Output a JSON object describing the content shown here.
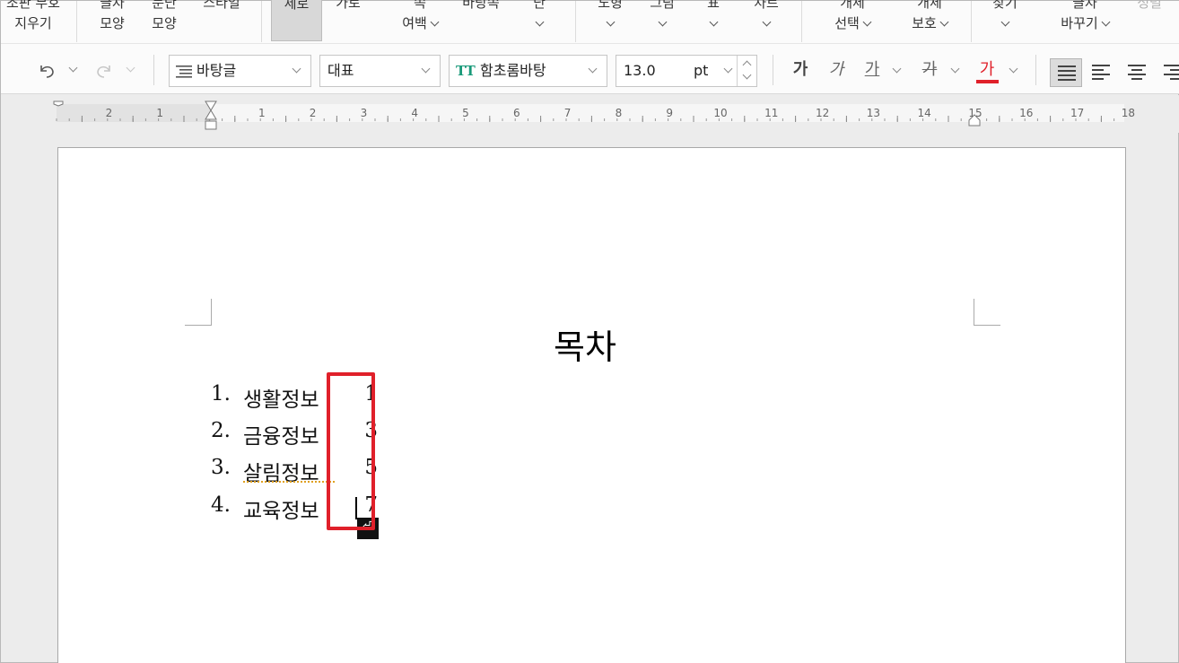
{
  "ribbon": {
    "items": [
      {
        "l1": "조판 부호",
        "l2": "지우기",
        "chev": false
      },
      {
        "l1": "글자",
        "l2": "모양",
        "chev": false
      },
      {
        "l1": "문단",
        "l2": "모양",
        "chev": false
      },
      {
        "l1": "스타일",
        "l2": "",
        "chev": false
      },
      {
        "l1": "세로",
        "l2": "",
        "chev": false,
        "active": true
      },
      {
        "l1": "가로",
        "l2": "",
        "chev": false
      },
      {
        "l1": "쪽",
        "l2": "여백",
        "chev": true
      },
      {
        "l1": "바탕쪽",
        "l2": "",
        "chev": true
      },
      {
        "l1": "단",
        "l2": "",
        "chev": true
      },
      {
        "l1": "도형",
        "l2": "",
        "chev": true
      },
      {
        "l1": "그림",
        "l2": "",
        "chev": true
      },
      {
        "l1": "표",
        "l2": "",
        "chev": true
      },
      {
        "l1": "차트",
        "l2": "",
        "chev": true
      },
      {
        "l1": "개체",
        "l2": "선택",
        "chev": true
      },
      {
        "l1": "개체",
        "l2": "보호",
        "chev": true
      },
      {
        "l1": "찾기",
        "l2": "",
        "chev": true
      },
      {
        "l1": "글자",
        "l2": "바꾸기",
        "chev": true
      },
      {
        "l1": "정렬",
        "l2": "",
        "chev": false,
        "dim": true
      }
    ]
  },
  "toolbar": {
    "style_value": "바탕글",
    "language_value": "대표",
    "font_value": "함초롬바탕",
    "font_icon": "TT",
    "size_value": "13.0",
    "size_unit": "pt",
    "bold_label": "가",
    "italic_label": "가",
    "underline_label": "가",
    "strike_label": "가",
    "color_label": "가",
    "text_color": "#e0202a"
  },
  "ruler": {
    "left_ticks": [
      "2",
      "1"
    ],
    "right_ticks": [
      "1",
      "2",
      "3",
      "4",
      "5",
      "6",
      "7",
      "8",
      "9",
      "10",
      "11",
      "12",
      "13",
      "14",
      "15",
      "16",
      "17",
      "18"
    ]
  },
  "document": {
    "title": "목차",
    "items": [
      {
        "num": "1.",
        "label": "생활정보",
        "page": "1"
      },
      {
        "num": "2.",
        "label": "금융정보",
        "page": "3"
      },
      {
        "num": "3.",
        "label": "살림정보",
        "page": "5"
      },
      {
        "num": "4.",
        "label": "교육정보",
        "page": "7"
      }
    ],
    "caret_marker": "⏎",
    "highlight_color": "#e0202a"
  }
}
